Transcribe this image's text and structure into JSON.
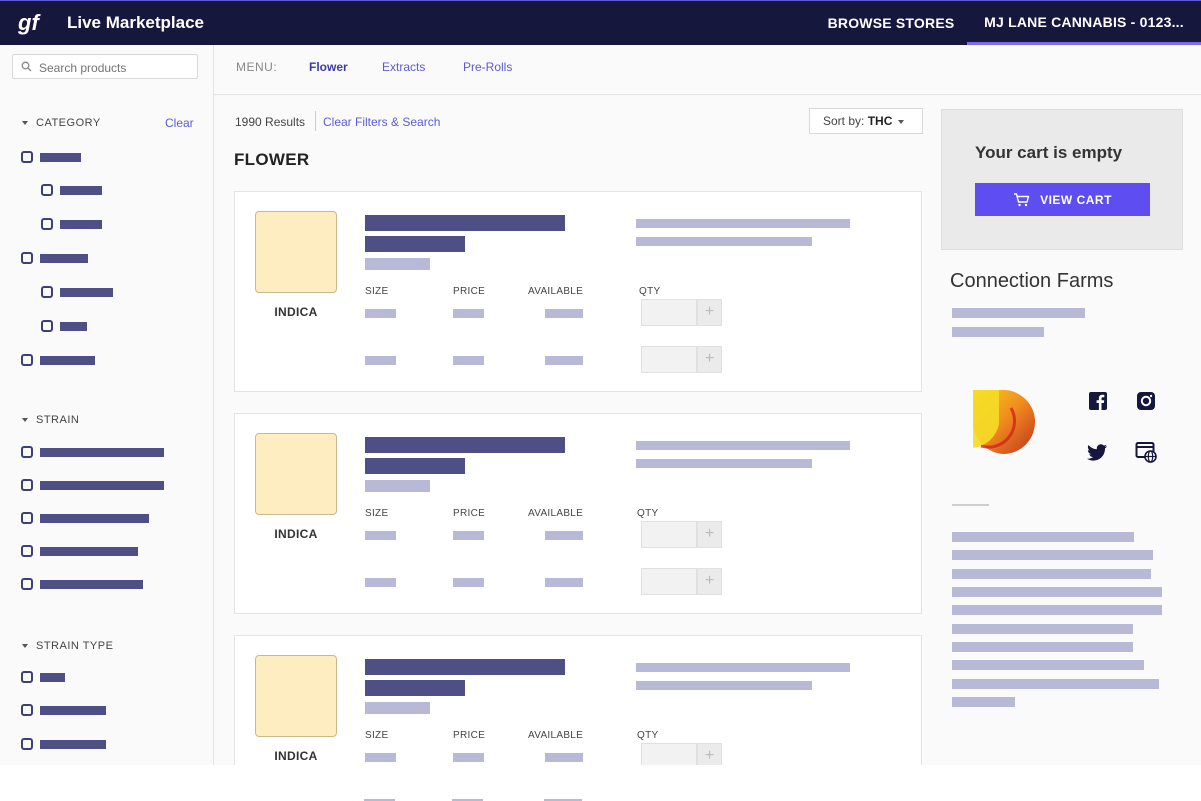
{
  "header": {
    "app_title": "Live Marketplace",
    "browse_stores": "BROWSE STORES",
    "store_name": "MJ LANE CANNABIS - 0123...",
    "logo_icon": "gf-logo-icon"
  },
  "sidebar": {
    "search_placeholder": "Search products",
    "category": {
      "label": "CATEGORY",
      "clear": "Clear"
    },
    "strain": {
      "label": "STRAIN"
    },
    "strain_type": {
      "label": "STRAIN TYPE"
    }
  },
  "menu": {
    "label": "MENU:",
    "tabs": [
      "Flower",
      "Extracts",
      "Pre-Rolls"
    ]
  },
  "results": {
    "count": "1990 Results",
    "clear_filters": "Clear Filters & Search",
    "sort_prefix": "Sort by:",
    "sort_value": "THC"
  },
  "section_heading": "FLOWER",
  "products": [
    {
      "type": "INDICA",
      "columns": [
        "SIZE",
        "PRICE",
        "AVAILABLE",
        "QTY"
      ],
      "plus": "+"
    },
    {
      "type": "INDICA",
      "columns": [
        "SIZE",
        "PRICE",
        "AVAILABLE",
        "QTY"
      ],
      "plus": "+"
    },
    {
      "type": "INDICA",
      "columns": [
        "SIZE",
        "PRICE",
        "AVAILABLE",
        "QTY"
      ],
      "plus": "+"
    }
  ],
  "cart": {
    "empty_text": "Your cart is empty",
    "view_cart": "VIEW CART"
  },
  "store": {
    "name": "Connection Farms",
    "social_icons": [
      "facebook-icon",
      "instagram-icon",
      "twitter-icon",
      "website-icon"
    ]
  },
  "colors": {
    "header_bg": "#16173d",
    "accent": "#5e4df1",
    "placeholder_dark": "#4d4f85",
    "placeholder_light": "#b8b9d6",
    "thumb_bg": "#fdedc0"
  }
}
